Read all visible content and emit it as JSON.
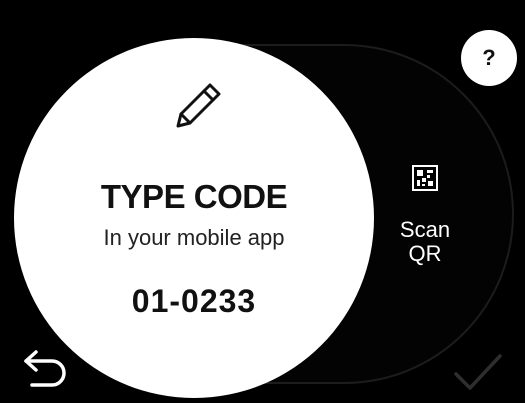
{
  "help": {
    "label": "?"
  },
  "code_entry": {
    "title": "TYPE CODE",
    "subtitle": "In your mobile app",
    "code": "01-0233",
    "icon": "pencil-icon"
  },
  "scan_qr": {
    "label_line1": "Scan",
    "label_line2": "QR",
    "icon": "qr-code-icon"
  },
  "navigation": {
    "back_icon": "back-arrow-icon",
    "confirm_icon": "check-icon",
    "confirm_enabled": false
  },
  "colors": {
    "background": "#000000",
    "panel": "#ffffff",
    "text_dark": "#111111",
    "text_light": "#ffffff",
    "disabled": "#2e2e2e"
  }
}
